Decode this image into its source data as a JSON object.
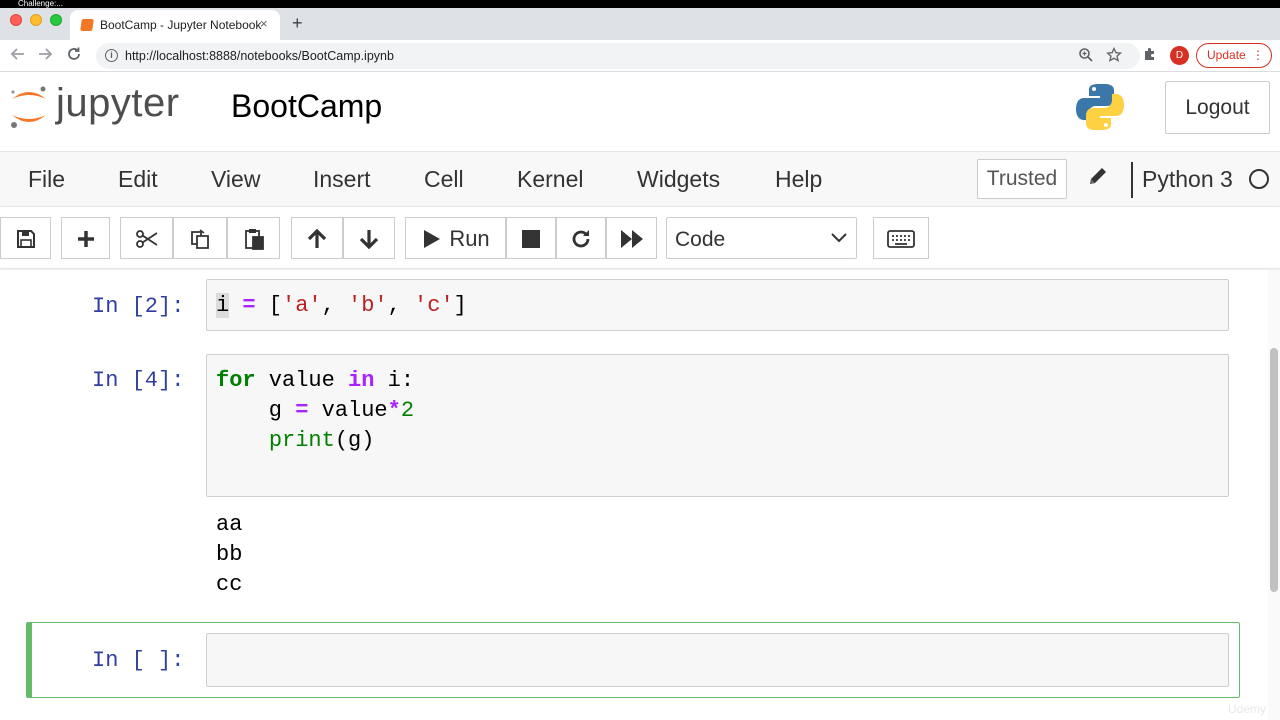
{
  "browser": {
    "window_caption": "Challenge:...",
    "tab_title": "BootCamp - Jupyter Notebook",
    "tab_close": "×",
    "new_tab": "+",
    "url": "http://localhost:8888/notebooks/BootCamp.ipynb",
    "avatar_letter": "D",
    "update_label": "Update",
    "update_menu": "⋮"
  },
  "header": {
    "logo_text": "jupyter",
    "notebook_title": "BootCamp",
    "logout_label": "Logout"
  },
  "menubar": {
    "items": [
      "File",
      "Edit",
      "View",
      "Insert",
      "Cell",
      "Kernel",
      "Widgets",
      "Help"
    ],
    "trusted_label": "Trusted",
    "kernel_name": "Python 3"
  },
  "toolbar": {
    "run_label": "Run",
    "cell_type": "Code"
  },
  "cells": [
    {
      "prompt": "In [2]:",
      "code": [
        "i = ['a', 'b', 'c']"
      ]
    },
    {
      "prompt": "In [4]:",
      "code": [
        "for value in i:",
        "    g = value*2",
        "    print(g)"
      ],
      "output": [
        "aa",
        "bb",
        "cc"
      ]
    },
    {
      "prompt": "In [ ]:",
      "code": []
    }
  ],
  "watermark": "Udemy",
  "colors": {
    "selected_cell_border": "#66bb6a",
    "prompt": "#303f9f",
    "keyword": "#008000",
    "operator": "#aa22ff",
    "string": "#ba2121"
  }
}
